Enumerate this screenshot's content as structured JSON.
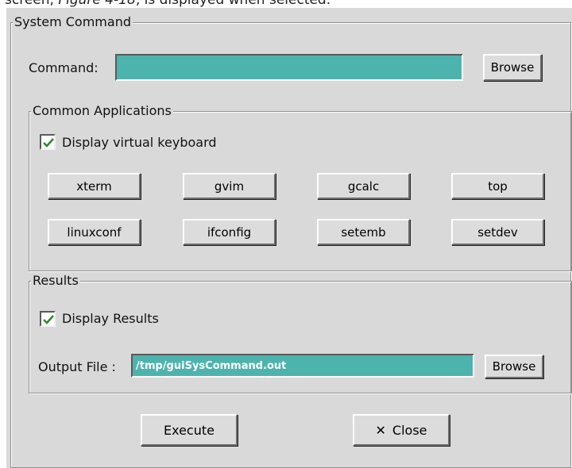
{
  "caption": {
    "text_before": "screen, ",
    "figure_ref": "Figure 4-18",
    "text_after": ", is displayed when selected."
  },
  "system_command": {
    "title": "System Command",
    "command_label": "Command:",
    "command_value": "",
    "browse_label": "Browse"
  },
  "common_apps": {
    "title": "Common Applications",
    "keyboard_checkbox": {
      "label": "Display virtual keyboard",
      "checked": true
    },
    "apps": [
      "xterm",
      "gvim",
      "gcalc",
      "top",
      "linuxconf",
      "ifconfig",
      "setemb",
      "setdev"
    ]
  },
  "results": {
    "title": "Results",
    "display_checkbox": {
      "label": "Display Results",
      "checked": true
    },
    "output_label": "Output File :",
    "output_value": "/tmp/guiSysCommand.out",
    "browse_label": "Browse"
  },
  "actions": {
    "execute_label": "Execute",
    "close_label": "Close",
    "close_icon": "x-icon"
  },
  "colors": {
    "field_bg": "#4db3ad",
    "dialog_bg": "#d9d9d9",
    "check_color": "#2e8b2e"
  }
}
